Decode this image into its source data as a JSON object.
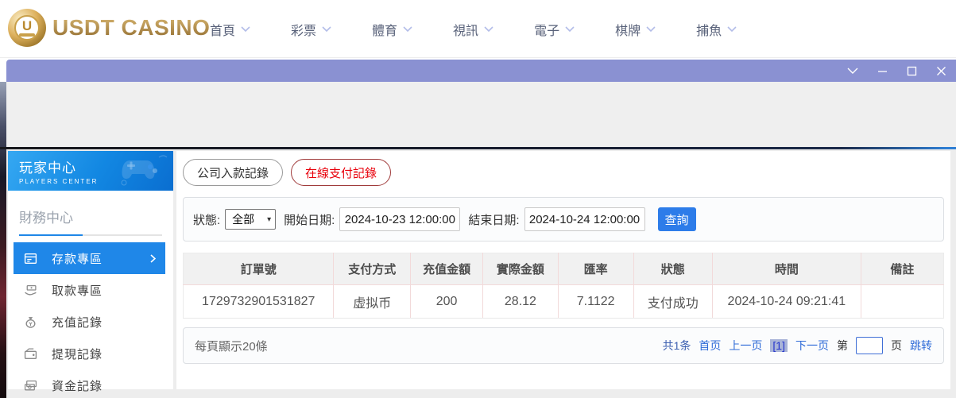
{
  "brand": {
    "name": "USDT CASINO",
    "logo_letter": "U"
  },
  "nav": {
    "items": [
      {
        "label": "首頁"
      },
      {
        "label": "彩票"
      },
      {
        "label": "體育"
      },
      {
        "label": "視訊"
      },
      {
        "label": "電子"
      },
      {
        "label": "棋牌"
      },
      {
        "label": "捕魚"
      }
    ]
  },
  "titlebar": {
    "icons": [
      "chevron-down-icon",
      "minimize-icon",
      "maximize-icon",
      "close-icon"
    ]
  },
  "sidebar": {
    "title": "玩家中心",
    "subtitle": "PLAYERS CENTER",
    "section": "財務中心",
    "items": [
      {
        "label": "存款專區",
        "icon": "deposit-icon",
        "active": true
      },
      {
        "label": "取款專區",
        "icon": "withdraw-icon",
        "active": false
      },
      {
        "label": "充值記錄",
        "icon": "recharge-record-icon",
        "active": false
      },
      {
        "label": "提現記錄",
        "icon": "withdrawal-record-icon",
        "active": false
      },
      {
        "label": "資金記錄",
        "icon": "funds-record-icon",
        "active": false
      }
    ]
  },
  "tabs": [
    {
      "label": "公司入款記錄",
      "active": false
    },
    {
      "label": "在線支付記錄",
      "active": true
    }
  ],
  "filter": {
    "status_label": "狀態:",
    "status_value": "全部",
    "start_label": "開始日期:",
    "start_value": "2024-10-23 12:00:00",
    "end_label": "結束日期:",
    "end_value": "2024-10-24 12:00:00",
    "search_label": "查詢"
  },
  "table": {
    "headers": [
      "訂單號",
      "支付方式",
      "充值金額",
      "實際金額",
      "匯率",
      "狀態",
      "時間",
      "備註"
    ],
    "rows": [
      [
        "1729732901531827",
        "虚拟币",
        "200",
        "28.12",
        "7.1122",
        "支付成功",
        "2024-10-24 09:21:41",
        ""
      ]
    ]
  },
  "pagination": {
    "page_size_text": "每頁顯示20條",
    "total_text": "共1条",
    "first": "首页",
    "prev": "上一页",
    "current": "[1]",
    "next": "下一页",
    "jump_prefix": "第",
    "jump_suffix": "页",
    "jump_button": "跳转",
    "jump_value": ""
  },
  "colors": {
    "brand_gold": "#b08b3d",
    "titlebar_purple": "#8a91d2",
    "sidebar_active_blue": "#1f87e8",
    "search_button_blue": "#2d7ce9",
    "tab_active_red": "#e8000b",
    "link_blue": "#2f6bd8"
  }
}
